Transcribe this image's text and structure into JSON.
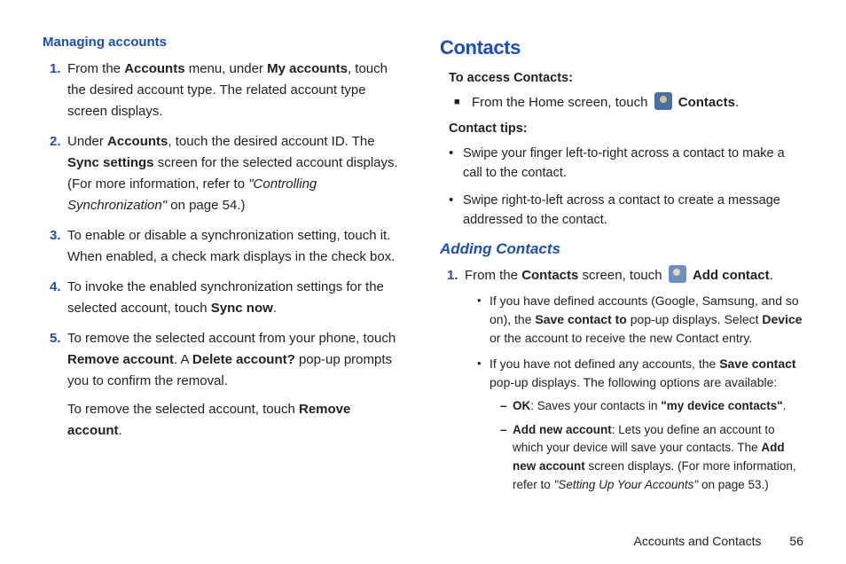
{
  "left": {
    "heading": "Managing accounts",
    "items": [
      {
        "num": "1.",
        "parts": [
          "From the ",
          "Accounts",
          " menu, under ",
          "My accounts",
          ", touch the desired account type. The related account type screen displays."
        ]
      },
      {
        "num": "2.",
        "parts": [
          "Under ",
          "Accounts",
          ", touch the desired account ID. The ",
          "Sync settings",
          " screen for the selected account displays. (For more information, refer to ",
          "\"Controlling Synchronization\"",
          " on page 54.)"
        ]
      },
      {
        "num": "3.",
        "parts": [
          "To enable or disable a synchronization setting, touch it. When enabled, a check mark displays in the check box."
        ]
      },
      {
        "num": "4.",
        "parts": [
          "To invoke the enabled synchronization settings for the selected account, touch ",
          "Sync now",
          "."
        ]
      },
      {
        "num": "5.",
        "parts": [
          "To remove the selected account from your phone, touch ",
          "Remove account",
          ". A ",
          "Delete account?",
          " pop-up prompts you to confirm the removal."
        ],
        "extra": [
          "To remove the selected account, touch ",
          "Remove account",
          "."
        ]
      }
    ]
  },
  "right": {
    "heading": "Contacts",
    "access_label": "To access Contacts:",
    "access_line_pre": "From the Home screen, touch ",
    "access_line_post": "Contacts",
    "access_line_end": ".",
    "tips_label": "Contact tips:",
    "tips": [
      "Swipe your finger left-to-right across a contact to make a call to the contact.",
      "Swipe right-to-left across a contact to create a message addressed to the contact."
    ],
    "adding_heading": "Adding Contacts",
    "step1": {
      "num": "1.",
      "pre": "From the ",
      "b1": "Contacts",
      "mid": " screen, touch ",
      "b2": "Add contact",
      "end": "."
    },
    "sub": [
      {
        "parts": [
          "If you have defined accounts (Google, Samsung, and so on), the ",
          "Save contact to",
          " pop-up displays. Select ",
          "Device",
          " or the account to receive the new Contact entry."
        ]
      },
      {
        "parts": [
          "If you have not defined any accounts, the ",
          "Save contact",
          " pop-up displays. The following options are available:"
        ],
        "dash": [
          {
            "b": "OK",
            "rest_pre": ": Saves your contacts in ",
            "q": "\"my device contacts\"",
            "rest_post": "."
          },
          {
            "b": "Add new account",
            "rest_pre": ": Lets you define an account to which your device will save your contacts. The ",
            "b2": "Add new account",
            "rest_mid": " screen displays. (For more information, refer to ",
            "i": "\"Setting Up Your Accounts\"",
            "rest_post": " on page 53.)"
          }
        ]
      }
    ]
  },
  "footer": {
    "section": "Accounts and Contacts",
    "page": "56"
  }
}
